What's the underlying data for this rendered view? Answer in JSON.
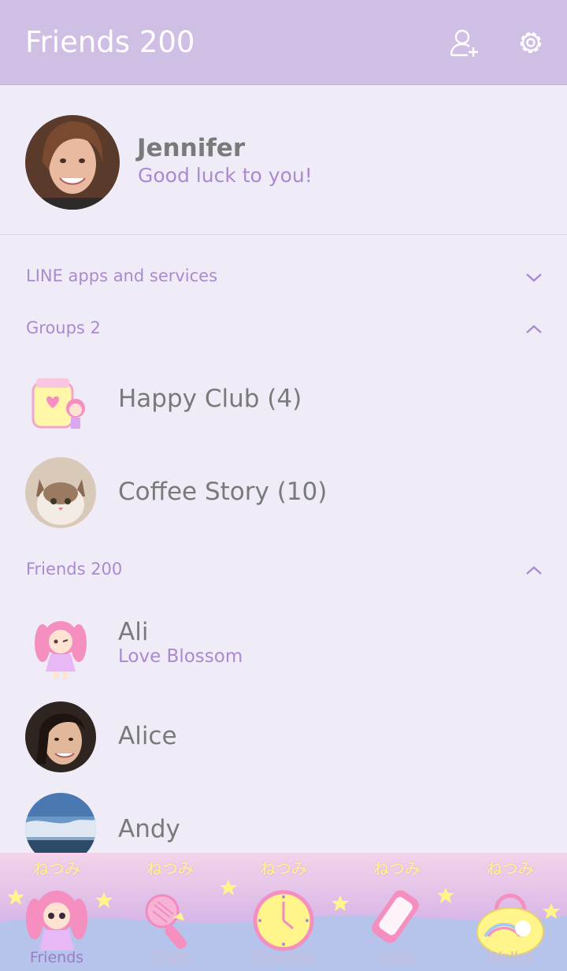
{
  "header": {
    "title": "Friends 200",
    "add_friend_icon": "person-add-icon",
    "settings_icon": "gear-icon"
  },
  "profile": {
    "name": "Jennifer",
    "status": "Good luck to you!"
  },
  "sections": {
    "line_apps": {
      "label": "LINE apps and services",
      "state": "collapsed"
    },
    "groups": {
      "label": "Groups 2",
      "state": "expanded"
    },
    "friends": {
      "label": "Friends 200",
      "state": "expanded"
    }
  },
  "groups": [
    {
      "name": "Happy Club (4)"
    },
    {
      "name": "Coffee Story (10)"
    }
  ],
  "friends": [
    {
      "name": "Ali",
      "status": "Love Blossom"
    },
    {
      "name": "Alice",
      "status": ""
    },
    {
      "name": "Andy",
      "status": ""
    }
  ],
  "tabs": [
    {
      "label": "Friends",
      "deco": "ねつみ",
      "icon": "character-icon",
      "active": true
    },
    {
      "label": "Chats",
      "deco": "ねつみ",
      "icon": "microphone-icon",
      "active": false
    },
    {
      "label": "Timeline",
      "deco": "ねつみ",
      "icon": "clock-icon",
      "active": false
    },
    {
      "label": "Calls",
      "deco": "ねつみ",
      "icon": "phone-icon",
      "active": false
    },
    {
      "label": "Wallet",
      "deco": "ねつみ",
      "icon": "bag-icon",
      "active": false
    }
  ],
  "colors": {
    "header_bg": "#cfbfe4",
    "accent": "#a98ad0",
    "page_bg": "#efecf7"
  }
}
